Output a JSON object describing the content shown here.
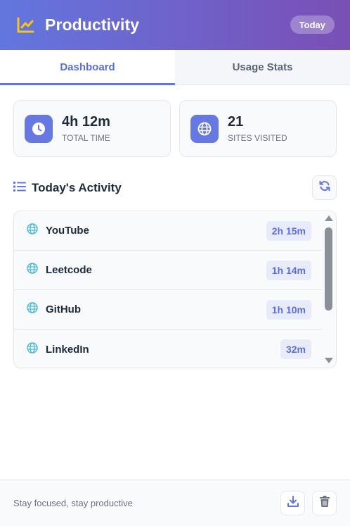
{
  "header": {
    "title": "Productivity",
    "logo_icon": "chart-line-icon",
    "badge": "Today",
    "gradient": [
      "#6376df",
      "#7a4fb5"
    ]
  },
  "tabs": [
    {
      "label": "Dashboard",
      "active": true
    },
    {
      "label": "Usage Stats",
      "active": false
    }
  ],
  "stats": [
    {
      "icon": "clock-icon",
      "value": "4h 12m",
      "label": "TOTAL TIME"
    },
    {
      "icon": "globe-icon",
      "value": "21",
      "label": "SITES VISITED"
    }
  ],
  "activity": {
    "title": "Today's Activity",
    "title_icon": "list-icon",
    "refresh_icon": "refresh-icon",
    "items": [
      {
        "name": "YouTube",
        "time": "2h 15m",
        "icon": "globe-icon"
      },
      {
        "name": "Leetcode",
        "time": "1h 14m",
        "icon": "globe-icon"
      },
      {
        "name": "GitHub",
        "time": "1h 10m",
        "icon": "globe-icon"
      },
      {
        "name": "LinkedIn",
        "time": "32m",
        "icon": "globe-icon"
      }
    ]
  },
  "footer": {
    "text": "Stay focused, stay productive",
    "export_icon": "download-icon",
    "clear_icon": "trash-icon"
  },
  "colors": {
    "accent": "#6376df",
    "logo": "#f5c518",
    "globe": "#4bb8d8"
  }
}
